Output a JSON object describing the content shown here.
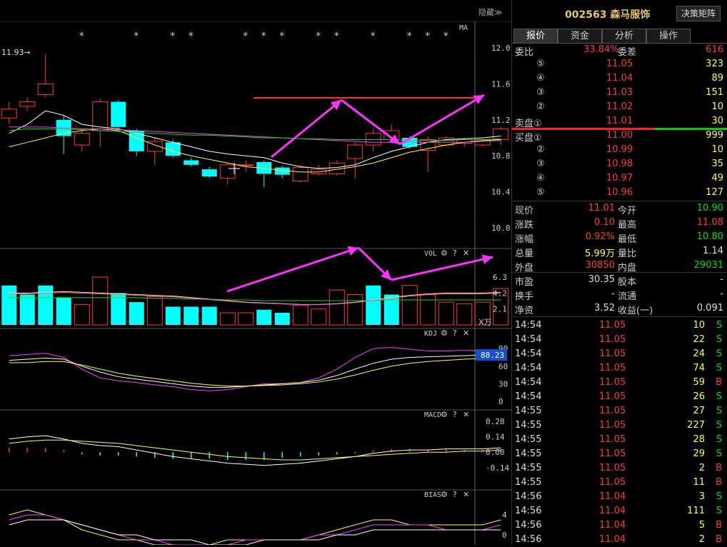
{
  "chart_toolbar": {
    "hide_label": "隐藏",
    "hide_arrows": "≫"
  },
  "main_chart": {
    "ma_label": "MA",
    "high_marker": "11.93",
    "star_glyph": "*",
    "price_ticks": [
      "12.0",
      "11.6",
      "11.2",
      "10.8",
      "10.4",
      "10.0"
    ]
  },
  "chart_data": [
    {
      "type": "candlestick",
      "title": "",
      "ylim": [
        10.0,
        12.0
      ],
      "candles": [
        {
          "o": 11.22,
          "c": 11.32,
          "h": 11.4,
          "l": 11.15
        },
        {
          "o": 11.35,
          "c": 11.4,
          "h": 11.45,
          "l": 11.3
        },
        {
          "o": 11.48,
          "c": 11.6,
          "h": 11.93,
          "l": 11.45
        },
        {
          "o": 11.2,
          "c": 11.02,
          "h": 11.25,
          "l": 10.82
        },
        {
          "o": 10.92,
          "c": 11.05,
          "h": 11.1,
          "l": 10.85
        },
        {
          "o": 11.08,
          "c": 11.4,
          "h": 11.44,
          "l": 10.9
        },
        {
          "o": 11.4,
          "c": 11.12,
          "h": 11.42,
          "l": 11.1
        },
        {
          "o": 11.08,
          "c": 10.85,
          "h": 11.1,
          "l": 10.8
        },
        {
          "o": 10.85,
          "c": 10.96,
          "h": 11.0,
          "l": 10.7
        },
        {
          "o": 10.95,
          "c": 10.8,
          "h": 10.98,
          "l": 10.78
        },
        {
          "o": 10.75,
          "c": 10.7,
          "h": 10.78,
          "l": 10.68
        },
        {
          "o": 10.65,
          "c": 10.57,
          "h": 10.68,
          "l": 10.55
        },
        {
          "o": 10.55,
          "c": 10.7,
          "h": 10.72,
          "l": 10.48
        },
        {
          "o": 10.7,
          "c": 10.7,
          "h": 10.75,
          "l": 10.62
        },
        {
          "o": 10.73,
          "c": 10.6,
          "h": 10.75,
          "l": 10.45
        },
        {
          "o": 10.67,
          "c": 10.59,
          "h": 10.69,
          "l": 10.55
        },
        {
          "o": 10.52,
          "c": 10.67,
          "h": 10.7,
          "l": 10.5
        },
        {
          "o": 10.6,
          "c": 10.65,
          "h": 10.7,
          "l": 10.58
        },
        {
          "o": 10.6,
          "c": 10.72,
          "h": 10.75,
          "l": 10.58
        },
        {
          "o": 10.77,
          "c": 10.92,
          "h": 10.95,
          "l": 10.55
        },
        {
          "o": 10.92,
          "c": 11.05,
          "h": 11.1,
          "l": 10.85
        },
        {
          "o": 10.98,
          "c": 11.08,
          "h": 11.15,
          "l": 10.95
        },
        {
          "o": 11.0,
          "c": 10.9,
          "h": 11.02,
          "l": 10.88
        },
        {
          "o": 10.86,
          "c": 10.98,
          "h": 11.02,
          "l": 10.62
        },
        {
          "o": 10.92,
          "c": 11.0,
          "h": 11.02,
          "l": 10.9
        },
        {
          "o": 10.94,
          "c": 10.98,
          "h": 11.0,
          "l": 10.9
        },
        {
          "o": 10.92,
          "c": 10.98,
          "h": 11.0,
          "l": 10.9
        },
        {
          "o": 10.98,
          "c": 11.1,
          "h": 11.12,
          "l": 10.92
        }
      ],
      "series": [
        {
          "values": [
            11.05,
            11.15,
            11.3,
            11.25,
            11.15,
            11.12,
            11.1,
            11.05,
            11.0,
            10.95,
            10.9,
            10.85,
            10.82,
            10.8,
            10.78,
            10.72,
            10.68,
            10.66,
            10.67,
            10.7,
            10.78,
            10.85,
            10.9,
            10.95,
            10.98,
            10.99,
            11.0,
            11.02
          ]
        },
        {
          "values": [
            10.9,
            10.95,
            11.0,
            11.05,
            11.08,
            11.1,
            11.08,
            11.0,
            10.92,
            10.85,
            10.8,
            10.76,
            10.72,
            10.68,
            10.66,
            10.64,
            10.62,
            10.62,
            10.65,
            10.68,
            10.72,
            10.78,
            10.84,
            10.88,
            10.92,
            10.95,
            10.97,
            10.98
          ]
        },
        {
          "values": [
            11.12,
            11.12,
            11.12,
            11.11,
            11.1,
            11.1,
            11.09,
            11.08,
            11.07,
            11.06,
            11.05,
            11.04,
            11.03,
            11.02,
            11.01,
            11.0,
            10.99,
            10.98,
            10.97,
            10.96,
            10.95,
            10.95,
            10.95,
            10.95,
            10.95,
            10.95,
            10.96,
            10.97
          ]
        },
        {
          "values": [
            11.08,
            11.1,
            11.1,
            11.1,
            11.09,
            11.08,
            11.07,
            11.06,
            11.05,
            11.04,
            11.03,
            11.03,
            11.02,
            11.01,
            11.0,
            11.0,
            10.99,
            10.99,
            10.98,
            10.98,
            10.98,
            10.98,
            10.97,
            10.97,
            10.97,
            10.98,
            10.98,
            10.99
          ]
        }
      ]
    },
    {
      "type": "bar",
      "title": "VOL",
      "ylim": [
        0,
        8
      ],
      "xlabel_unit": "X万",
      "ticks": [
        "6.3",
        "4.2",
        "2.1"
      ],
      "values": [
        5.2,
        4.0,
        5.2,
        3.6,
        2.7,
        6.3,
        4.2,
        3.0,
        3.7,
        2.4,
        2.4,
        2.4,
        1.6,
        1.6,
        2.0,
        1.6,
        2.6,
        2.1,
        4.6,
        4.0,
        5.2,
        4.0,
        5.2,
        4.0,
        3.0,
        2.8,
        3.0,
        4.8
      ],
      "up": [
        false,
        false,
        false,
        false,
        true,
        true,
        false,
        false,
        true,
        false,
        false,
        false,
        true,
        true,
        false,
        false,
        true,
        true,
        true,
        true,
        false,
        false,
        true,
        true,
        true,
        true,
        true,
        true
      ],
      "series": [
        {
          "values": [
            4.2,
            4.2,
            4.3,
            4.4,
            4.3,
            4.2,
            4.1,
            4.0,
            3.9,
            3.8,
            3.6,
            3.4,
            3.2,
            3.0,
            2.9,
            2.8,
            2.7,
            2.7,
            2.8,
            3.0,
            3.3,
            3.6,
            3.9,
            4.1,
            4.2,
            4.2,
            4.2,
            4.3
          ]
        },
        {
          "values": [
            3.6,
            3.6,
            3.6,
            3.6,
            3.6,
            3.6,
            3.6,
            3.6,
            3.5,
            3.5,
            3.4,
            3.4,
            3.3,
            3.3,
            3.2,
            3.2,
            3.2,
            3.2,
            3.2,
            3.2,
            3.2,
            3.3,
            3.3,
            3.3,
            3.3,
            3.3,
            3.3,
            3.3
          ]
        }
      ]
    },
    {
      "type": "line",
      "title": "KDJ",
      "ylim": [
        0,
        100
      ],
      "ticks": [
        "90",
        "60",
        "30",
        "0"
      ],
      "current_value": "88.23",
      "series": [
        {
          "values": [
            78,
            80,
            82,
            75,
            55,
            40,
            35,
            32,
            28,
            25,
            20,
            18,
            20,
            25,
            30,
            30,
            32,
            40,
            55,
            75,
            90,
            92,
            89,
            86,
            86,
            87,
            86,
            88
          ]
        },
        {
          "values": [
            70,
            72,
            74,
            72,
            60,
            50,
            42,
            38,
            34,
            30,
            26,
            24,
            24,
            26,
            28,
            30,
            32,
            36,
            44,
            55,
            65,
            72,
            75,
            76,
            77,
            78,
            79,
            80
          ]
        },
        {
          "values": [
            66,
            66,
            68,
            68,
            62,
            55,
            48,
            43,
            39,
            35,
            31,
            28,
            26,
            26,
            27,
            28,
            30,
            33,
            38,
            45,
            53,
            60,
            65,
            68,
            70,
            72,
            73,
            75
          ]
        }
      ]
    },
    {
      "type": "line",
      "title": "MACD",
      "ylim": [
        -0.2,
        0.32
      ],
      "ticks": [
        "0.28",
        "0.14",
        "0.00",
        "-0.14"
      ],
      "series": [
        {
          "values": [
            0.12,
            0.14,
            0.15,
            0.12,
            0.08,
            0.06,
            0.05,
            0.02,
            -0.01,
            -0.04,
            -0.06,
            -0.08,
            -0.1,
            -0.11,
            -0.12,
            -0.11,
            -0.1,
            -0.08,
            -0.06,
            -0.04,
            -0.01,
            0.01,
            0.02,
            0.02,
            0.03,
            0.03,
            0.03,
            0.04
          ]
        },
        {
          "values": [
            0.08,
            0.1,
            0.11,
            0.11,
            0.1,
            0.09,
            0.08,
            0.06,
            0.04,
            0.02,
            0.0,
            -0.02,
            -0.04,
            -0.05,
            -0.06,
            -0.07,
            -0.07,
            -0.06,
            -0.05,
            -0.04,
            -0.03,
            -0.02,
            -0.01,
            0.0,
            0.0,
            0.01,
            0.01,
            0.02
          ]
        }
      ],
      "histogram": [
        0.04,
        0.04,
        0.04,
        0.02,
        -0.02,
        -0.03,
        -0.03,
        -0.04,
        -0.05,
        -0.06,
        -0.06,
        -0.06,
        -0.07,
        -0.07,
        -0.07,
        -0.05,
        -0.04,
        -0.03,
        -0.02,
        -0.01,
        0.02,
        0.03,
        0.03,
        0.02,
        0.03,
        0.02,
        0.02,
        0.03
      ]
    },
    {
      "type": "line",
      "title": "BIAS",
      "ylim": [
        -2,
        7
      ],
      "ticks": [
        "4",
        "0"
      ],
      "series": [
        {
          "values": [
            4,
            5,
            4,
            3,
            1,
            0,
            -1,
            -1,
            -2,
            -2,
            -2,
            -2,
            -1,
            -1,
            -1,
            -1,
            -1,
            0,
            1,
            2,
            3,
            3,
            2,
            2,
            2,
            2,
            2,
            3
          ]
        },
        {
          "values": [
            3,
            4,
            4,
            3,
            2,
            1,
            0,
            -1,
            -1,
            -2,
            -2,
            -2,
            -2,
            -1,
            -1,
            -1,
            -1,
            0,
            0,
            1,
            2,
            2,
            2,
            2,
            1,
            1,
            1,
            2
          ]
        },
        {
          "values": [
            2,
            3,
            3,
            3,
            2,
            1,
            0,
            0,
            -1,
            -1,
            -1,
            -2,
            -2,
            -2,
            -1,
            -1,
            -1,
            -1,
            0,
            0,
            1,
            1,
            1,
            1,
            1,
            1,
            1,
            1
          ]
        }
      ]
    }
  ],
  "indicator_icons": {
    "gear": "⚙",
    "help": "?",
    "close": "✕"
  },
  "colors": {
    "up": "#ff3b3b",
    "down": "#00ffff",
    "white_line": "#ffffff",
    "yellow_line": "#ffff40",
    "magenta_line": "#ff40ff",
    "green_line": "#00e000",
    "annotation": "#ff33ff"
  },
  "panel": {
    "stock_code": "002563",
    "stock_name": "森马服饰",
    "decision_button": "决策矩阵",
    "tabs": [
      "报价",
      "资金",
      "分析",
      "操作"
    ],
    "weibi": {
      "label": "委比",
      "value": "33.84%",
      "label2": "委差",
      "value2": "616"
    },
    "sell_orders": [
      {
        "level": "⑤",
        "price": "11.05",
        "volume": "323"
      },
      {
        "level": "④",
        "price": "11.04",
        "volume": "89"
      },
      {
        "level": "③",
        "price": "11.03",
        "volume": "151"
      },
      {
        "level": "②",
        "price": "11.02",
        "volume": "10"
      },
      {
        "level": "卖盘①",
        "price": "11.01",
        "volume": "30"
      }
    ],
    "buy_orders": [
      {
        "level": "买盘①",
        "price": "11.00",
        "volume": "999"
      },
      {
        "level": "②",
        "price": "10.99",
        "volume": "10"
      },
      {
        "level": "③",
        "price": "10.98",
        "volume": "35"
      },
      {
        "level": "④",
        "price": "10.97",
        "volume": "49"
      },
      {
        "level": "⑤",
        "price": "10.96",
        "volume": "127"
      }
    ],
    "stats": [
      {
        "l1": "现价",
        "v1": "11.01",
        "c1": "red",
        "l2": "今开",
        "v2": "10.90",
        "c2": "green"
      },
      {
        "l1": "涨跌",
        "v1": "0.10",
        "c1": "red",
        "l2": "最高",
        "v2": "11.08",
        "c2": "red"
      },
      {
        "l1": "涨幅",
        "v1": "0.92%",
        "c1": "red",
        "l2": "最低",
        "v2": "10.80",
        "c2": "green"
      },
      {
        "l1": "总量",
        "v1": "5.99万",
        "c1": "yellow",
        "l2": "量比",
        "v2": "1.14",
        "c2": "white"
      },
      {
        "l1": "外盘",
        "v1": "30850",
        "c1": "red",
        "l2": "内盘",
        "v2": "29031",
        "c2": "green"
      }
    ],
    "fundamentals": [
      {
        "l1": "市盈",
        "v1": "30.35",
        "l2": "股本",
        "v2": "-"
      },
      {
        "l1": "换手",
        "v1": "-",
        "l2": "流通",
        "v2": "-"
      },
      {
        "l1": "净资",
        "v1": "3.52",
        "l2": "收益(一)",
        "v2": "0.091"
      }
    ],
    "ticks": [
      {
        "time": "14:54",
        "price": "11.05",
        "vol": "10",
        "side": "S"
      },
      {
        "time": "14:54",
        "price": "11.05",
        "vol": "22",
        "side": "S"
      },
      {
        "time": "14:54",
        "price": "11.05",
        "vol": "24",
        "side": "S"
      },
      {
        "time": "14:54",
        "price": "11.05",
        "vol": "74",
        "side": "S"
      },
      {
        "time": "14:54",
        "price": "11.05",
        "vol": "59",
        "side": "B"
      },
      {
        "time": "14:54",
        "price": "11.05",
        "vol": "26",
        "side": "S"
      },
      {
        "time": "14:55",
        "price": "11.05",
        "vol": "27",
        "side": "S"
      },
      {
        "time": "14:55",
        "price": "11.05",
        "vol": "227",
        "side": "S"
      },
      {
        "time": "14:55",
        "price": "11.05",
        "vol": "28",
        "side": "S"
      },
      {
        "time": "14:55",
        "price": "11.05",
        "vol": "29",
        "side": "S"
      },
      {
        "time": "14:55",
        "price": "11.05",
        "vol": "2",
        "side": "B"
      },
      {
        "time": "14:55",
        "price": "11.05",
        "vol": "11",
        "side": "B"
      },
      {
        "time": "14:56",
        "price": "11.04",
        "vol": "3",
        "side": "S"
      },
      {
        "time": "14:56",
        "price": "11.04",
        "vol": "111",
        "side": "S"
      },
      {
        "time": "14:56",
        "price": "11.04",
        "vol": "5",
        "side": "B"
      },
      {
        "time": "14:56",
        "price": "11.04",
        "vol": "2",
        "side": "B"
      }
    ]
  }
}
